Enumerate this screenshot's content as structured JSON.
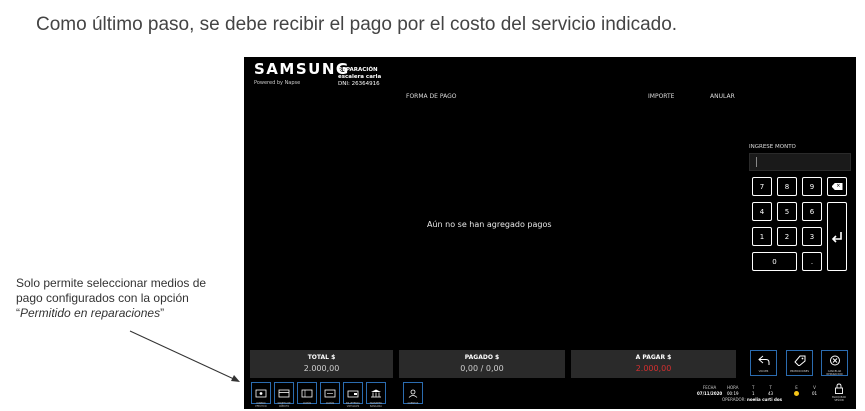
{
  "slide": {
    "heading": "Como último paso, se debe recibir el pago por el costo del servicio indicado.",
    "note_line1": "Solo permite seleccionar medios de",
    "note_line2": "pago configurados con la opción",
    "note_quote": "Permitido en reparaciones"
  },
  "app": {
    "brand": "SAMSUNG",
    "brand_sub": "Powered by Napse",
    "repair_title": "REPARACIÓN",
    "customer_name": "escalera carla",
    "customer_dni": "DNI: 26364916",
    "columns": {
      "forma_pago": "FORMA DE PAGO",
      "importe": "IMPORTE",
      "anular": "ANULAR"
    },
    "empty_message": "Aún no se han agregado pagos",
    "amount_label": "INGRESE MONTO",
    "keypad": [
      "7",
      "8",
      "9",
      "4",
      "5",
      "6",
      "1",
      "2",
      "3",
      "0",
      "."
    ],
    "totals": {
      "total_label": "TOTAL $",
      "total_value": "2.000,00",
      "paid_label": "PAGADO $",
      "paid_value": "0,00 / 0,00",
      "due_label": "A PAGAR $",
      "due_value": "2.000,00"
    },
    "actions": {
      "back": "VOLVER",
      "promos": "PROMOCIONES",
      "cancel": "CANCELAR REPARACION"
    },
    "bottom_buttons": [
      "DINERO EFECTIVO",
      "TARJETA DE CRÉDITO",
      "CUPÓN",
      "CUPÓN",
      "BILLETERAS VIRTUALES",
      "TRANSFER. BANCARIA",
      "CUENTAS"
    ],
    "status": {
      "fecha_label": "FECHA",
      "fecha": "07/11/2020",
      "hora_label": "HORA",
      "hora": "00:19",
      "t1_label": "T",
      "t1": "1",
      "t2_label": "T",
      "t2": "43",
      "e_label": "E",
      "v_label": "V",
      "v": "01",
      "operator_label": "OPERADOR:",
      "operator": "noelia curti dos",
      "lock_label": "BLOQUEAR SESIÓN"
    },
    "colors": {
      "accent": "#2b6cb0",
      "due": "#d32f2f",
      "paid": "#cfcfcf",
      "status_dot": "#f5c518"
    }
  }
}
